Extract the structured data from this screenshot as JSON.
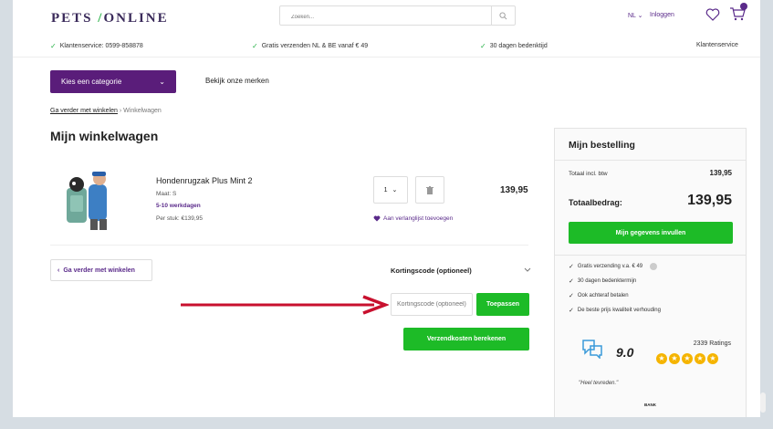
{
  "header": {
    "logo_left": "PETS",
    "logo_right": "ONLINE",
    "search_placeholder": "Zoeken...",
    "lang": "NL",
    "login": "Inloggen"
  },
  "usp_bar": {
    "items": [
      "Klantenservice: 0599-858878",
      "Gratis verzenden NL & BE vanaf € 49",
      "30 dagen bedenktijd"
    ],
    "service_link": "Klantenservice"
  },
  "nav": {
    "category_button": "Kies een categorie",
    "brands_link": "Bekijk onze merken"
  },
  "breadcrumb": {
    "continue": "Ga verder met winkelen",
    "separator": "›",
    "current": "Winkelwagen"
  },
  "cart": {
    "title": "Mijn winkelwagen",
    "item": {
      "name": "Hondenrugzak Plus Mint 2",
      "size": "Maat: S",
      "delivery": "5-10 werkdagen",
      "unit_price": "Per stuk: €139,95",
      "quantity": "1",
      "price": "139,95",
      "wishlist": "Aan verlanglijst toevoegen"
    },
    "back_button": "Ga verder met winkelen",
    "coupon_title": "Kortingscode (optioneel)",
    "coupon_placeholder": "Kortingscode (optioneel)",
    "apply_button": "Toepassen",
    "shipping_button": "Verzendkosten berekenen"
  },
  "order": {
    "title": "Mijn bestelling",
    "subtotal_label": "Totaal incl. btw",
    "subtotal_value": "139,95",
    "total_label": "Totaalbedrag:",
    "total_value": "139,95",
    "checkout_button": "Mijn gegevens invullen",
    "usps": [
      "Gratis verzending v.a. € 49",
      "30 dagen bedenktermijn",
      "Ook achteraf betalen",
      "De beste prijs kwaliteit verhouding"
    ],
    "rating_score": "9.0",
    "rating_count": "2339 Ratings",
    "quote": "\"Heel tevreden.\"",
    "bank_label": "BANK"
  },
  "colors": {
    "brand_purple": "#5a1d7a",
    "green": "#1dbb27",
    "arrow_red": "#c8102e",
    "star": "#f5b400"
  }
}
